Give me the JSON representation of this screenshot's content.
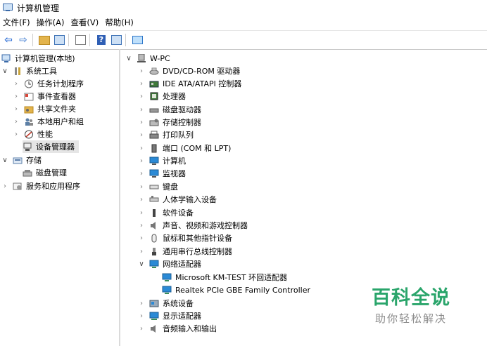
{
  "window": {
    "title": "计算机管理"
  },
  "menu": [
    "文件(F)",
    "操作(A)",
    "查看(V)",
    "帮助(H)"
  ],
  "toolbar": {
    "icons": [
      "back-icon",
      "forward-icon",
      "up-folder-icon",
      "show-tree-icon",
      "properties-icon",
      "help-icon",
      "action-pane-icon",
      "monitor-icon"
    ]
  },
  "left_tree": [
    {
      "label": "计算机管理(本地)",
      "icon": "computer-management-icon"
    },
    {
      "label": "系统工具",
      "icon": "tools-icon"
    },
    {
      "label": "任务计划程序",
      "icon": "clock-icon"
    },
    {
      "label": "事件查看器",
      "icon": "event-viewer-icon"
    },
    {
      "label": "共享文件夹",
      "icon": "shared-folder-icon"
    },
    {
      "label": "本地用户和组",
      "icon": "users-icon"
    },
    {
      "label": "性能",
      "icon": "performance-icon"
    },
    {
      "label": "设备管理器",
      "icon": "device-manager-icon"
    },
    {
      "label": "存储",
      "icon": "storage-icon"
    },
    {
      "label": "磁盘管理",
      "icon": "disk-icon"
    },
    {
      "label": "服务和应用程序",
      "icon": "services-icon"
    }
  ],
  "device_tree": {
    "root": "W-PC",
    "categories": [
      "DVD/CD-ROM 驱动器",
      "IDE ATA/ATAPI 控制器",
      "处理器",
      "磁盘驱动器",
      "存储控制器",
      "打印队列",
      "端口 (COM 和 LPT)",
      "计算机",
      "监视器",
      "键盘",
      "人体学输入设备",
      "软件设备",
      "声音、视频和游戏控制器",
      "鼠标和其他指针设备",
      "通用串行总线控制器",
      "网络适配器",
      "Microsoft KM-TEST 环回适配器",
      "Realtek PCIe GBE Family Controller",
      "系统设备",
      "显示适配器",
      "音频输入和输出"
    ]
  },
  "watermark": {
    "line1": "百科全说",
    "line2": "助你轻松解决"
  },
  "colors": {
    "accent": "#2a6cd5",
    "selection": "#e5e5e5",
    "watermark_green": "#2aa56b"
  }
}
